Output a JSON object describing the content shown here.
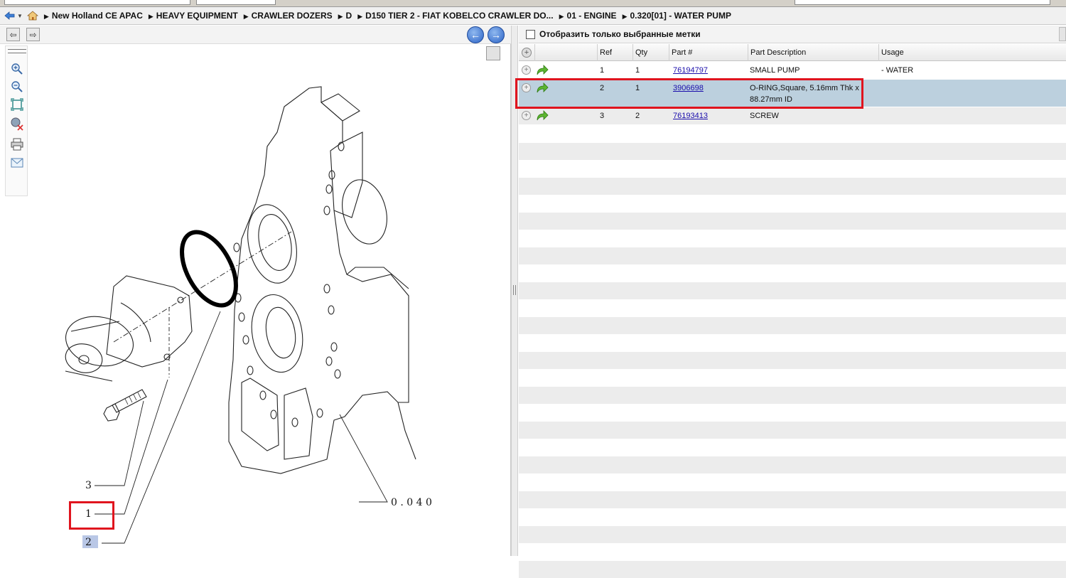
{
  "breadcrumb": {
    "items": [
      "New Holland CE APAC",
      "HEAVY EQUIPMENT",
      "CRAWLER DOZERS",
      "D",
      "D150 TIER 2 - FIAT KOBELCO CRAWLER DO...",
      "01 - ENGINE",
      "0.320[01] - WATER PUMP"
    ]
  },
  "filter": {
    "label": "Отобразить только выбранные метки"
  },
  "grid": {
    "columns": [
      "Ref",
      "Qty",
      "Part #",
      "Part Description",
      "Usage"
    ],
    "rows": [
      {
        "ref": "1",
        "qty": "1",
        "part": "76194797",
        "desc": "SMALL PUMP",
        "desc2": "",
        "usage": "- WATER"
      },
      {
        "ref": "2",
        "qty": "1",
        "part": "3906698",
        "desc": "O-RING,Square, 5.16mm Thk x",
        "desc2": "88.27mm ID",
        "usage": ""
      },
      {
        "ref": "3",
        "qty": "2",
        "part": "76193413",
        "desc": "SCREW",
        "desc2": "",
        "usage": ""
      }
    ]
  },
  "drawing": {
    "callouts": [
      "3",
      "1",
      "2"
    ],
    "reference": "0 . 0 4 0"
  },
  "colors": {
    "selected_row": "#bcd0de",
    "highlight": "#e0141e",
    "link": "#1a0dab",
    "stripe": "#ececec"
  },
  "icons": {
    "back": "back-arrow-icon",
    "home": "home-icon",
    "nav_prev": "left-circle-arrow-icon",
    "nav_next": "right-circle-arrow-icon",
    "zoom_in": "zoom-in-icon",
    "zoom_out": "zoom-out-icon",
    "fit": "fit-page-icon",
    "reset": "reset-zoom-icon",
    "print": "print-icon",
    "email": "email-icon",
    "expand": "expand-plus-icon",
    "go": "green-go-arrow-icon"
  }
}
